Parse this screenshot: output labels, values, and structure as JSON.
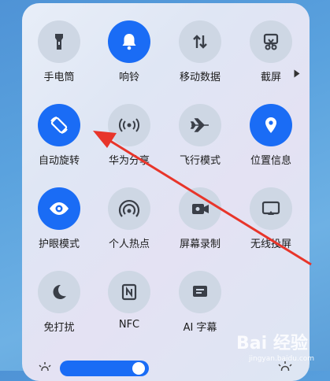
{
  "tiles": [
    {
      "label": "手电筒",
      "icon": "flashlight-icon",
      "active": false
    },
    {
      "label": "响铃",
      "icon": "bell-icon",
      "active": true
    },
    {
      "label": "移动数据",
      "icon": "mobile-data-icon",
      "active": false
    },
    {
      "label": "截屏",
      "icon": "screenshot-icon",
      "active": false
    },
    {
      "label": "自动旋转",
      "icon": "auto-rotate-icon",
      "active": true
    },
    {
      "label": "华为分享",
      "icon": "huawei-share-icon",
      "active": false
    },
    {
      "label": "飞行模式",
      "icon": "airplane-icon",
      "active": false
    },
    {
      "label": "位置信息",
      "icon": "location-icon",
      "active": true
    },
    {
      "label": "护眼模式",
      "icon": "eye-icon",
      "active": true
    },
    {
      "label": "个人热点",
      "icon": "hotspot-icon",
      "active": false
    },
    {
      "label": "屏幕录制",
      "icon": "screen-record-icon",
      "active": false
    },
    {
      "label": "无线投屏",
      "icon": "wireless-projection-icon",
      "active": false
    },
    {
      "label": "免打扰",
      "icon": "moon-icon",
      "active": false
    },
    {
      "label": "NFC",
      "icon": "nfc-icon",
      "active": false
    },
    {
      "label": "AI 字幕",
      "icon": "subtitle-icon",
      "active": false
    }
  ],
  "brightness": {
    "level_fraction": 0.35
  },
  "colors": {
    "accent": "#1a6cf5",
    "inactive": "#ced7e4",
    "annotation": "#e8352a"
  },
  "watermark": {
    "brand": "Bai 经验",
    "url": "jingyan.baidu.com"
  }
}
